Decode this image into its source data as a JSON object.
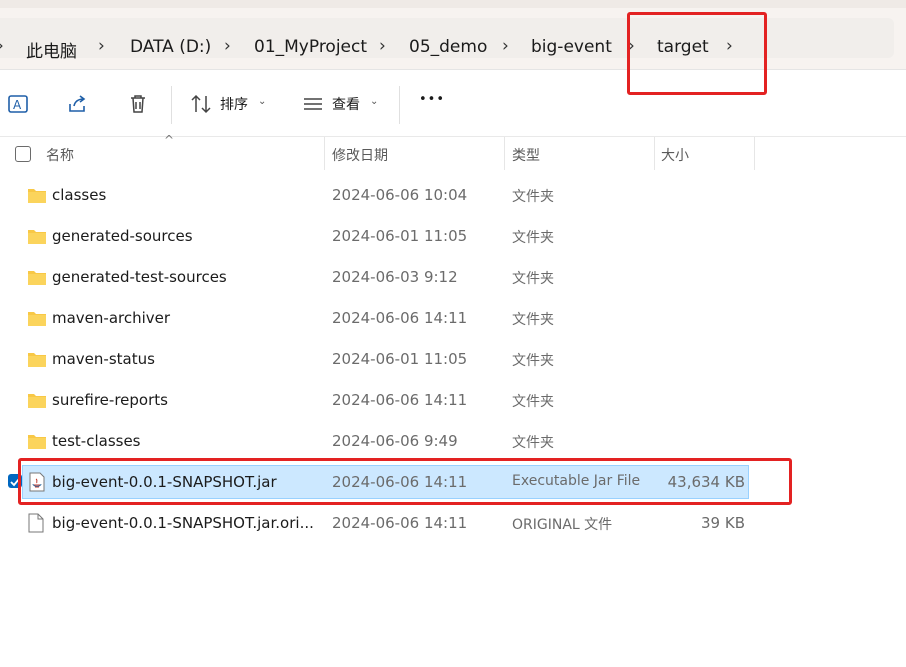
{
  "breadcrumb": {
    "items": [
      "此电脑",
      "DATA (D:)",
      "01_MyProject",
      "05_demo",
      "big-event",
      "target"
    ]
  },
  "toolbar": {
    "sort_label": "排序",
    "view_label": "查看",
    "more_label": "•••"
  },
  "columns": {
    "name": "名称",
    "date": "修改日期",
    "type": "类型",
    "size": "大小"
  },
  "rows": [
    {
      "name": "classes",
      "date": "2024-06-06 10:04",
      "type": "文件夹",
      "size": "",
      "icon": "folder-icon"
    },
    {
      "name": "generated-sources",
      "date": "2024-06-01 11:05",
      "type": "文件夹",
      "size": "",
      "icon": "folder-icon"
    },
    {
      "name": "generated-test-sources",
      "date": "2024-06-03 9:12",
      "type": "文件夹",
      "size": "",
      "icon": "folder-icon"
    },
    {
      "name": "maven-archiver",
      "date": "2024-06-06 14:11",
      "type": "文件夹",
      "size": "",
      "icon": "folder-icon"
    },
    {
      "name": "maven-status",
      "date": "2024-06-01 11:05",
      "type": "文件夹",
      "size": "",
      "icon": "folder-icon"
    },
    {
      "name": "surefire-reports",
      "date": "2024-06-06 14:11",
      "type": "文件夹",
      "size": "",
      "icon": "folder-icon"
    },
    {
      "name": "test-classes",
      "date": "2024-06-06 9:49",
      "type": "文件夹",
      "size": "",
      "icon": "folder-icon"
    },
    {
      "name": "big-event-0.0.1-SNAPSHOT.jar",
      "date": "2024-06-06 14:11",
      "type": "Executable Jar File",
      "size": "43,634 KB",
      "icon": "jar-file-icon",
      "selected": true
    },
    {
      "name": "big-event-0.0.1-SNAPSHOT.jar.ori...",
      "date": "2024-06-06 14:11",
      "type": "ORIGINAL 文件",
      "size": "39 KB",
      "icon": "file-icon"
    }
  ],
  "colors": {
    "highlight": "#e32222",
    "selection_bg": "#cce8ff",
    "folder": "#f8c846",
    "checkbox": "#0067c0"
  }
}
